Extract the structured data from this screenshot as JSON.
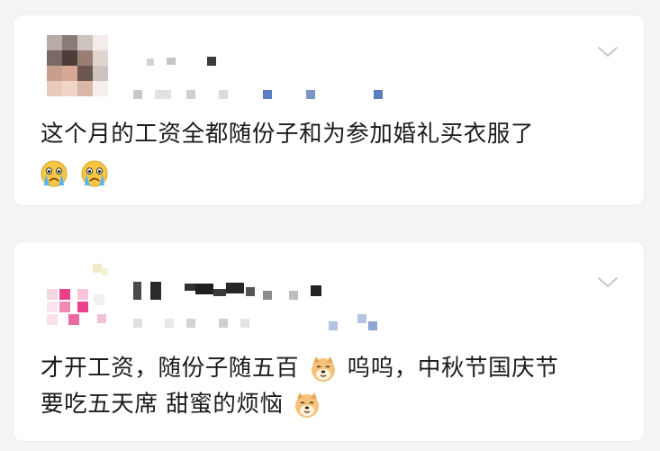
{
  "colors": {
    "background": "#f4f4f4",
    "card": "#ffffff",
    "text": "#1b1b1b",
    "chevron": "#c9c9c9",
    "link_blue": "#5b7ec0"
  },
  "posts": [
    {
      "author_name": "",
      "timestamp": "",
      "text": "这个月的工资全都随份子和为参加婚礼买衣服了",
      "trailing_emojis": [
        "crying-face-emoji",
        "crying-face-emoji"
      ]
    },
    {
      "author_name": "",
      "timestamp": "",
      "line1_a": "才开工资，随份子随五百",
      "line1_b": "呜呜，中秋节国庆节",
      "line2": "要吃五天席 甜蜜的烦恼",
      "inline_emojis": [
        "doge-dog-emoji",
        "doge-dog-emoji"
      ]
    }
  ]
}
